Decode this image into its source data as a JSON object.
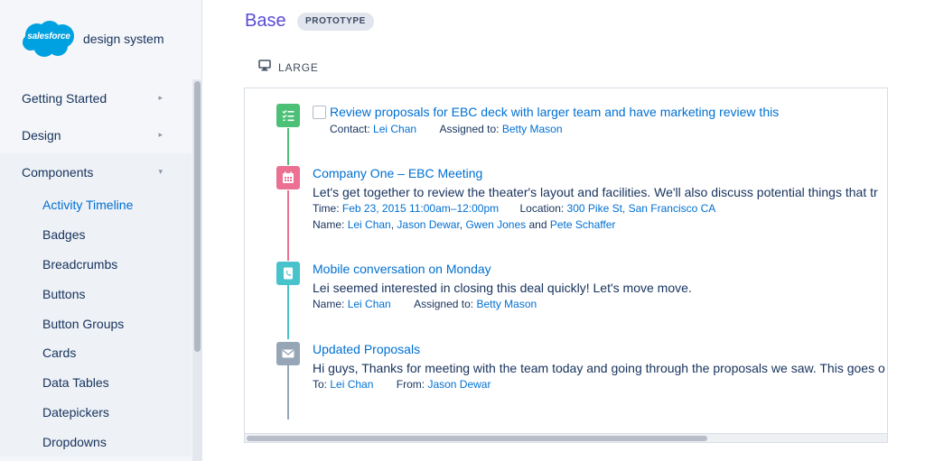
{
  "brand": {
    "cloud_text": "salesforce",
    "name": "design system"
  },
  "nav": {
    "top_items": [
      {
        "label": "Getting Started"
      },
      {
        "label": "Design"
      },
      {
        "label": "Components"
      }
    ],
    "sub_items": [
      {
        "label": "Activity Timeline"
      },
      {
        "label": "Badges"
      },
      {
        "label": "Breadcrumbs"
      },
      {
        "label": "Buttons"
      },
      {
        "label": "Button Groups"
      },
      {
        "label": "Cards"
      },
      {
        "label": "Data Tables"
      },
      {
        "label": "Datepickers"
      },
      {
        "label": "Dropdowns"
      }
    ],
    "active_item": "Activity Timeline"
  },
  "header": {
    "title": "Base",
    "badge": "PROTOTYPE"
  },
  "size_option": {
    "label": "LARGE",
    "icon": "desktop-icon"
  },
  "colors": {
    "task": "#4bc076",
    "event": "#eb7092",
    "call": "#48c3cc",
    "email": "#97a6b6",
    "link": "#0070d2",
    "title_purple": "#5a4bd6"
  },
  "timeline": [
    {
      "type": "task",
      "icon": "task-icon",
      "title": "Review proposals for EBC deck with larger team and have marketing review this",
      "meta": [
        {
          "label": "Contact:",
          "value": "Lei Chan"
        },
        {
          "label": "Assigned to:",
          "value": "Betty Mason"
        }
      ]
    },
    {
      "type": "event",
      "icon": "calendar-icon",
      "title": "Company One – EBC Meeting",
      "body": "Let's get together to review the theater's layout and facilities. We'll also discuss potential things that tr",
      "meta_time": {
        "label": "Time:",
        "value": "Feb 23, 2015 11:00am–12:00pm"
      },
      "meta_location": {
        "label": "Location:",
        "value": "300 Pike St, San Francisco CA"
      },
      "meta_names": {
        "label": "Name:",
        "names": [
          "Lei Chan",
          "Jason Dewar",
          "Gwen Jones"
        ],
        "and": "and",
        "last": "Pete Schaffer"
      }
    },
    {
      "type": "call",
      "icon": "phone-icon",
      "title": "Mobile conversation on Monday",
      "body": "Lei seemed interested in closing this deal quickly! Let's move move.",
      "meta": [
        {
          "label": "Name:",
          "value": "Lei Chan"
        },
        {
          "label": "Assigned to:",
          "value": "Betty Mason"
        }
      ]
    },
    {
      "type": "email",
      "icon": "email-icon",
      "title": "Updated Proposals",
      "body": "Hi guys, Thanks for meeting with the team today and going through the proposals we saw. This goes o",
      "meta": [
        {
          "label": "To:",
          "value": "Lei Chan"
        },
        {
          "label": "From:",
          "value": "Jason Dewar"
        }
      ]
    }
  ]
}
